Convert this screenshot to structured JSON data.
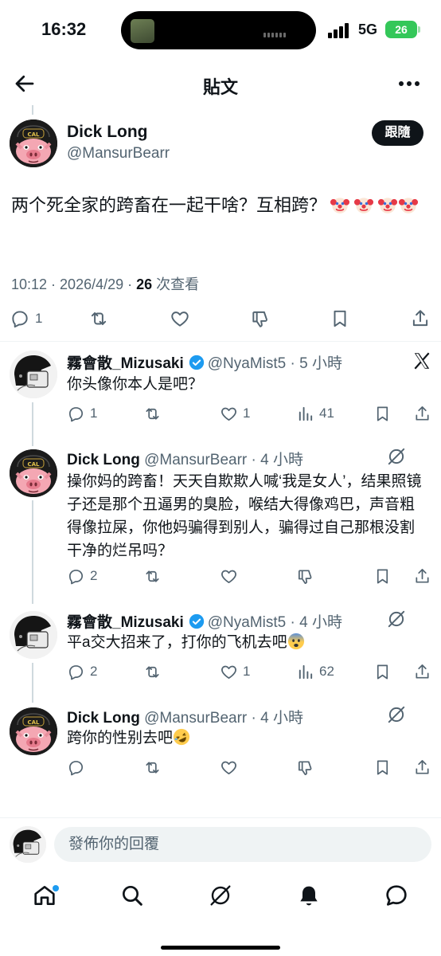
{
  "status_bar": {
    "time": "16:32",
    "network": "5G",
    "battery": "26"
  },
  "header": {
    "title": "貼文"
  },
  "main_post": {
    "author_name": "Dick Long",
    "author_handle": "@MansurBearr",
    "follow_label": "跟隨",
    "text": "两个死全家的跨畜在一起干啥？互相跨？",
    "time": "10:12",
    "date": "2026/4/29",
    "views": "26",
    "views_label": "次查看",
    "reply_count": "1"
  },
  "replies": [
    {
      "name": "霧會散_Mizusaki",
      "handle": "@NyaMist5",
      "time": "5 小時",
      "text": "你头像你本人是吧？",
      "replies": "1",
      "likes": "1",
      "views": "41"
    },
    {
      "name": "Dick Long",
      "handle": "@MansurBearr",
      "time": "4 小時",
      "text": "操你妈的跨畜！天天自欺欺人喊‘我是女人’，结果照镜子还是那个丑逼男的臭脸，喉结大得像鸡巴，声音粗得像拉屎，你他妈骗得到别人，骗得过自己那根没割干净的烂吊吗？",
      "replies": "2"
    },
    {
      "name": "霧會散_Mizusaki",
      "handle": "@NyaMist5",
      "time": "4 小時",
      "text": "平a交大招来了，打你的飞机去吧",
      "replies": "2",
      "likes": "1",
      "views": "62"
    },
    {
      "name": "Dick Long",
      "handle": "@MansurBearr",
      "time": "4 小時",
      "text": "跨你的性别去吧"
    }
  ],
  "compose": {
    "placeholder": "發佈你的回覆"
  },
  "icons": [
    "back-icon",
    "more-icon",
    "reply-icon",
    "retweet-icon",
    "like-icon",
    "dislike-icon",
    "bookmark-icon",
    "share-icon",
    "x-logo-icon",
    "grok-icon",
    "home-icon",
    "search-icon",
    "bell-icon",
    "messages-icon"
  ],
  "colors": {
    "text": "#0f1419",
    "secondary": "#536471",
    "verified": "#1d9bf0",
    "battery": "#34c759"
  }
}
